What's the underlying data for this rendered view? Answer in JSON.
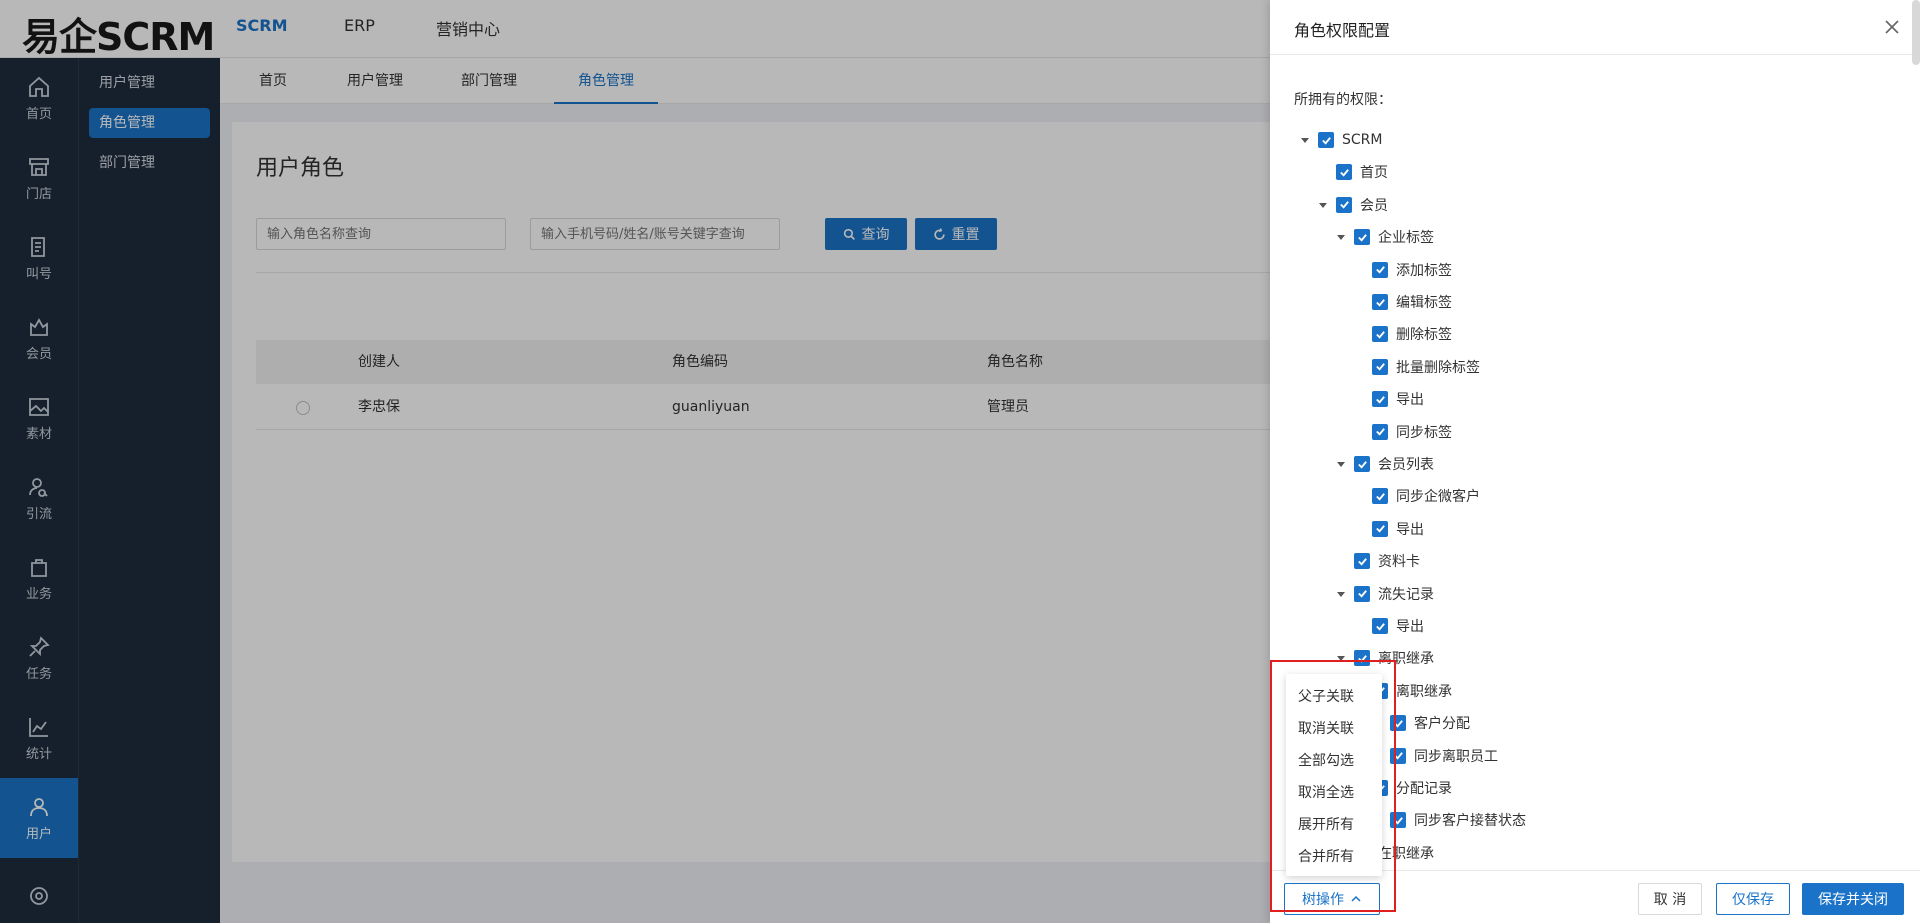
{
  "topbar": {
    "logo": "易企SCRM",
    "nav": [
      "SCRM",
      "ERP",
      "营销中心"
    ]
  },
  "iconbar": [
    "首页",
    "门店",
    "叫号",
    "会员",
    "素材",
    "引流",
    "业务",
    "任务",
    "统计",
    "用户"
  ],
  "subbar": [
    "用户管理",
    "角色管理",
    "部门管理"
  ],
  "tabs": [
    "首页",
    "用户管理",
    "部门管理",
    "角色管理"
  ],
  "page": {
    "title": "用户角色",
    "search_role_placeholder": "输入角色名称查询",
    "search_user_placeholder": "输入手机号码/姓名/账号关键字查询",
    "query_label": "查询",
    "reset_label": "重置",
    "columns": [
      "创建人",
      "角色编码",
      "角色名称"
    ],
    "rows": [
      {
        "creator": "李忠保",
        "code": "guanliyuan",
        "name": "管理员"
      }
    ]
  },
  "drawer": {
    "title": "角色权限配置",
    "perm_label": "所拥有的权限：",
    "tree": [
      {
        "label": "SCRM",
        "level": 0,
        "arrow": true
      },
      {
        "label": "首页",
        "level": 1,
        "arrow": false
      },
      {
        "label": "会员",
        "level": 1,
        "arrow": true
      },
      {
        "label": "企业标签",
        "level": 2,
        "arrow": true
      },
      {
        "label": "添加标签",
        "level": 3,
        "arrow": false
      },
      {
        "label": "编辑标签",
        "level": 3,
        "arrow": false
      },
      {
        "label": "删除标签",
        "level": 3,
        "arrow": false
      },
      {
        "label": "批量删除标签",
        "level": 3,
        "arrow": false
      },
      {
        "label": "导出",
        "level": 3,
        "arrow": false
      },
      {
        "label": "同步标签",
        "level": 3,
        "arrow": false
      },
      {
        "label": "会员列表",
        "level": 2,
        "arrow": true
      },
      {
        "label": "同步企微客户",
        "level": 3,
        "arrow": false
      },
      {
        "label": "导出",
        "level": 3,
        "arrow": false
      },
      {
        "label": "资料卡",
        "level": 2,
        "arrow": false
      },
      {
        "label": "流失记录",
        "level": 2,
        "arrow": true
      },
      {
        "label": "导出",
        "level": 3,
        "arrow": false
      },
      {
        "label": "离职继承",
        "level": 2,
        "arrow": true
      },
      {
        "label": "离职继承",
        "level": 3,
        "arrow": true
      },
      {
        "label": "客户分配",
        "level": 4,
        "arrow": false
      },
      {
        "label": "同步离职员工",
        "level": 4,
        "arrow": false
      },
      {
        "label": "分配记录",
        "level": 3,
        "arrow": true
      },
      {
        "label": "同步客户接替状态",
        "level": 4,
        "arrow": false
      },
      {
        "label": "在职继承",
        "level": 2,
        "arrow": true
      }
    ],
    "cancel_label": "取 消",
    "save_label": "仅保存",
    "save_close_label": "保存并关闭",
    "tree_ops_label": "树操作",
    "menu": [
      "父子关联",
      "取消关联",
      "全部勾选",
      "取消全选",
      "展开所有",
      "合并所有"
    ]
  },
  "colors": {
    "accent": "#1a73c8",
    "sidebar": "#1f2d3d",
    "highlight": "#e02020"
  }
}
